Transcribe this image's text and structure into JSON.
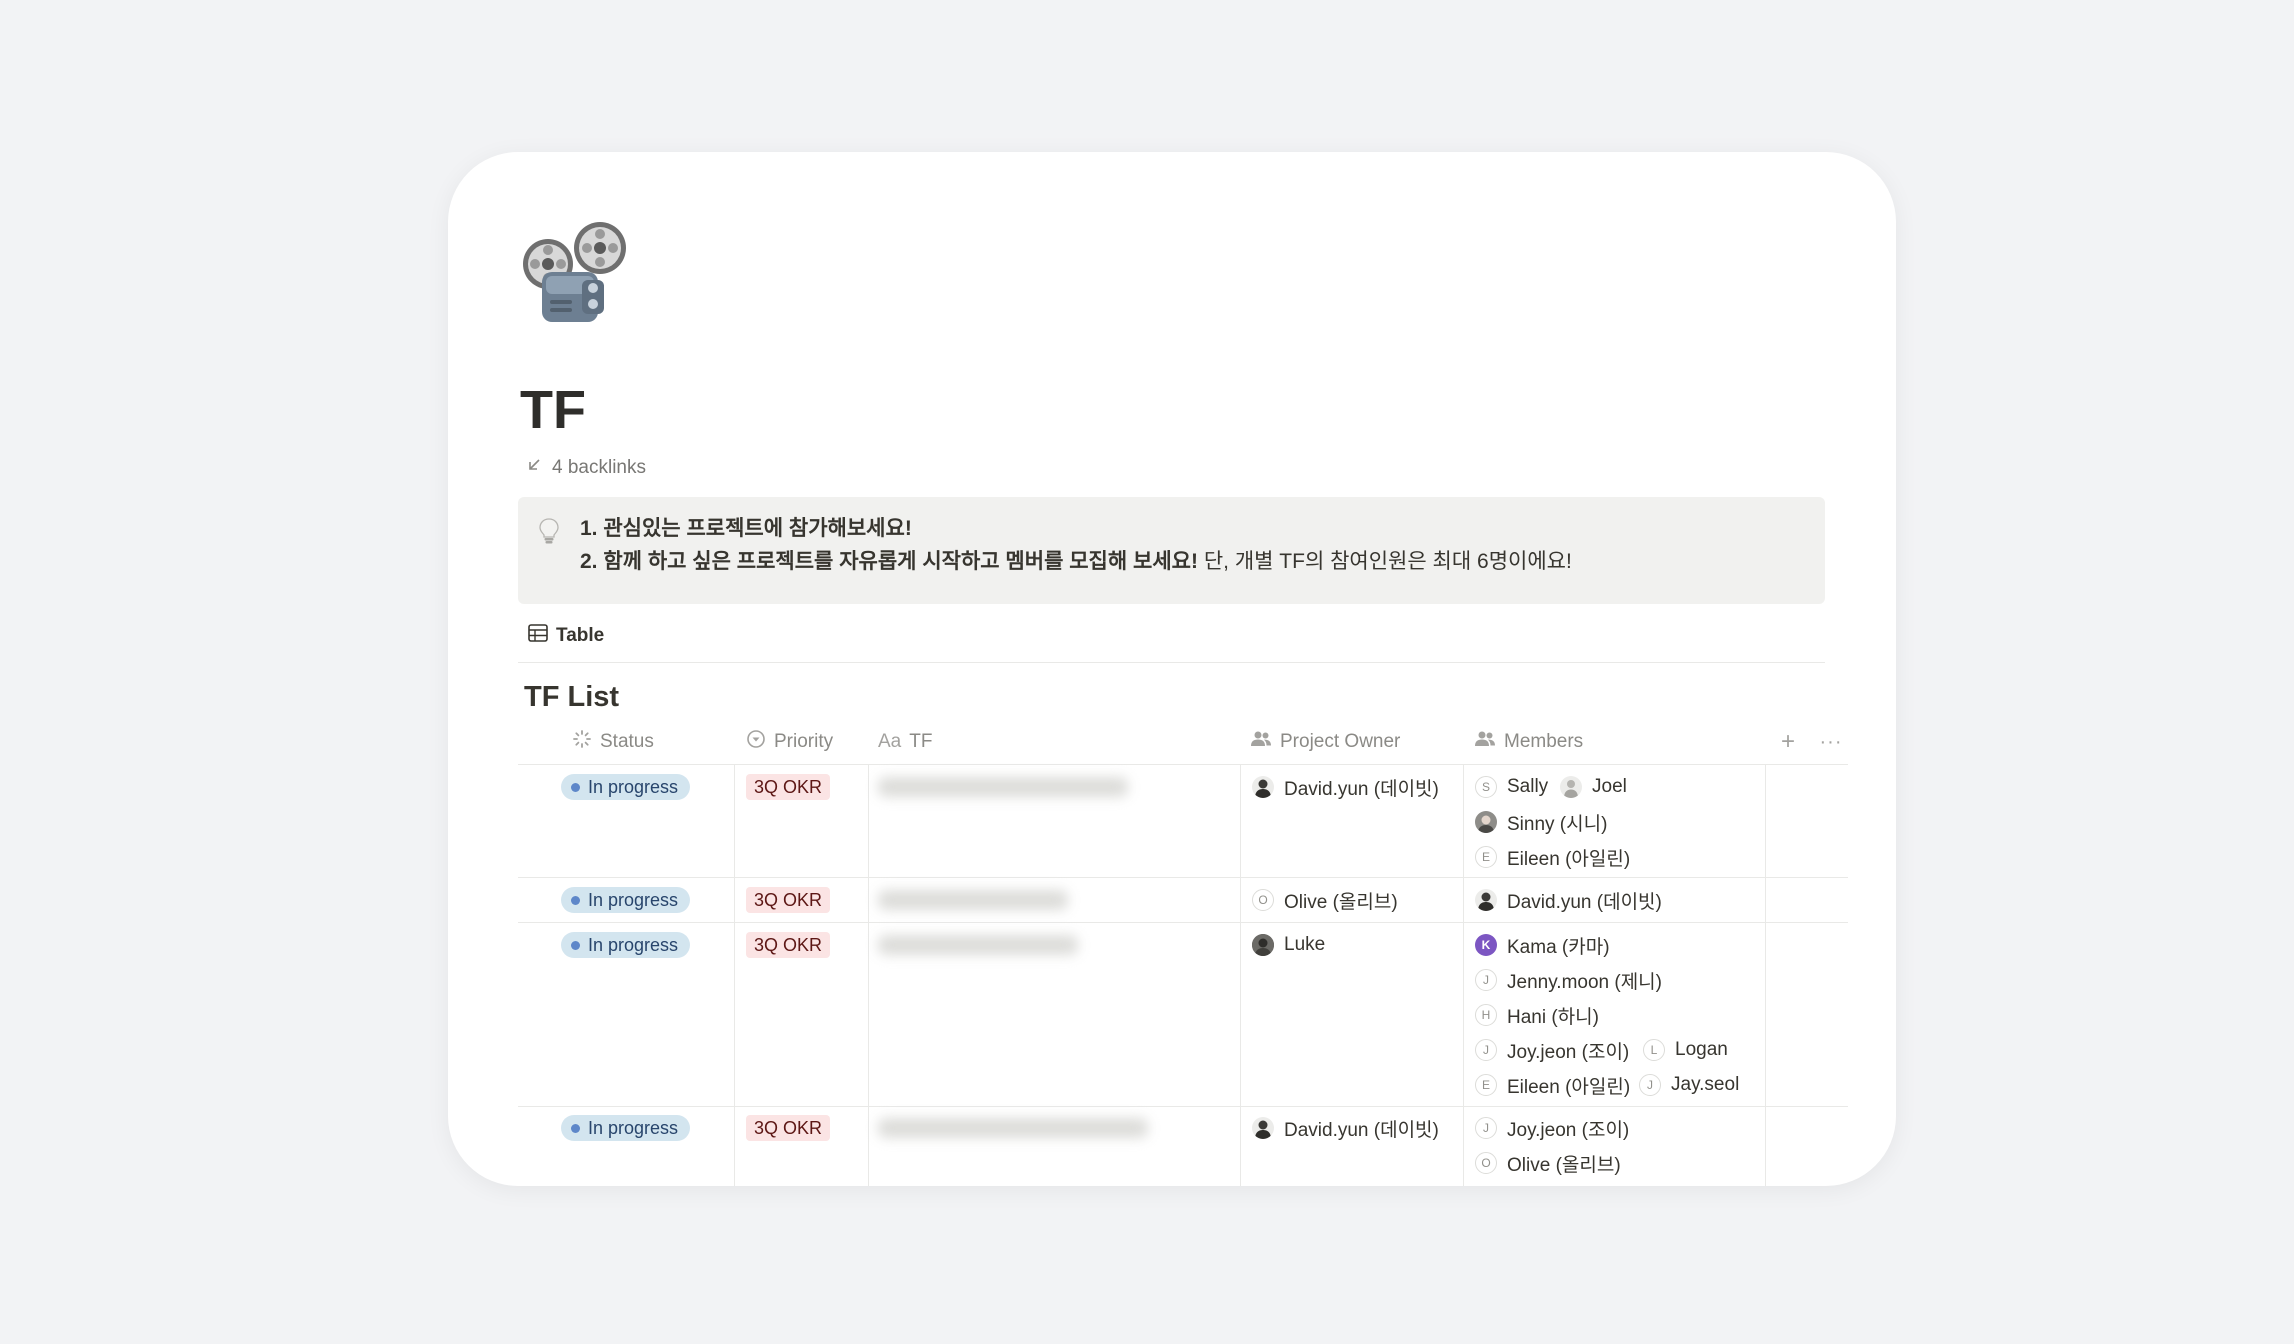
{
  "page": {
    "icon": "film-projector-icon",
    "title": "TF",
    "backlinks": "4 backlinks"
  },
  "callout": {
    "icon": "lightbulb-icon",
    "line1": "1. 관심있는 프로젝트에 참가해보세요!",
    "line2_bold": "2. 함께 하고 싶은 프로젝트를 자유롭게 시작하고 멤버를 모집해 보세요!",
    "line2_normal": "단, 개별 TF의 참여인원은 최대 6명이에요!"
  },
  "view": {
    "tab_label": "Table",
    "icon": "table-icon"
  },
  "database": {
    "title": "TF List",
    "columns": {
      "status": "Status",
      "priority": "Priority",
      "tf": "TF",
      "tf_type_prefix": "Aa",
      "owner": "Project Owner",
      "members": "Members"
    },
    "add_column_icon": "+",
    "more_icon": "···",
    "rows": [
      {
        "status": "In progress",
        "priority": "3Q OKR",
        "owner": {
          "name": "David.yun (데이빗)",
          "avatar": "photo"
        },
        "members": [
          {
            "name": "Sally",
            "initial": "S"
          },
          {
            "name": "Joel",
            "avatar": "photo"
          },
          {
            "name": "Sinny (시니)",
            "avatar": "photo"
          },
          {
            "name": "Eileen (아일린)",
            "initial": "E"
          }
        ]
      },
      {
        "status": "In progress",
        "priority": "3Q OKR",
        "owner": {
          "name": "Olive (올리브)",
          "initial": "O"
        },
        "members": [
          {
            "name": "David.yun (데이빗)",
            "avatar": "photo"
          }
        ]
      },
      {
        "status": "In progress",
        "priority": "3Q OKR",
        "owner": {
          "name": "Luke",
          "avatar": "photo"
        },
        "members": [
          {
            "name": "Kama (카마)",
            "initial": "K"
          },
          {
            "name": "Jenny.moon (제니)",
            "initial": "J"
          },
          {
            "name": "Hani (하니)",
            "initial": "H"
          },
          {
            "name": "Joy.jeon (조이)",
            "initial": "J"
          },
          {
            "name": "Logan",
            "initial": "L"
          },
          {
            "name": "Eileen (아일린)",
            "initial": "E"
          },
          {
            "name": "Jay.seol",
            "initial": "J"
          }
        ]
      },
      {
        "status": "In progress",
        "priority": "3Q OKR",
        "owner": {
          "name": "David.yun (데이빗)",
          "avatar": "photo"
        },
        "members": [
          {
            "name": "Joy.jeon (조이)",
            "initial": "J"
          },
          {
            "name": "Olive (올리브)",
            "initial": "O"
          }
        ]
      }
    ]
  },
  "colors": {
    "background": "#f2f3f5",
    "status_pill_bg": "#d3e5ef",
    "status_dot": "#5e87c9",
    "priority_tag_bg": "#fbe4e4",
    "callout_bg": "#f1f1ef",
    "kama_avatar": "#7c56c2"
  }
}
